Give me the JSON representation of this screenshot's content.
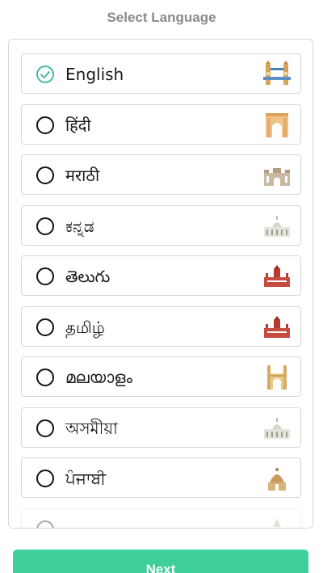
{
  "header": {
    "title": "Select Language"
  },
  "languages": [
    {
      "label": "English",
      "selected": true,
      "landmark_icon": "tower-bridge-icon"
    },
    {
      "label": "हिंदी",
      "selected": false,
      "landmark_icon": "india-gate-icon"
    },
    {
      "label": "मराठी",
      "selected": false,
      "landmark_icon": "gateway-of-india-icon"
    },
    {
      "label": "ಕನ್ನಡ",
      "selected": false,
      "landmark_icon": "vidhana-soudha-icon"
    },
    {
      "label": "తెలుగు",
      "selected": false,
      "landmark_icon": "palace-icon"
    },
    {
      "label": "தமிழ்",
      "selected": false,
      "landmark_icon": "palace-icon"
    },
    {
      "label": "മലയാളം",
      "selected": false,
      "landmark_icon": "charminar-icon"
    },
    {
      "label": "অসমীয়া",
      "selected": false,
      "landmark_icon": "vidhana-soudha-icon"
    },
    {
      "label": "ਪੰਜਾਬੀ",
      "selected": false,
      "landmark_icon": "temple-icon"
    }
  ],
  "footer": {
    "next_label": "Next"
  },
  "colors": {
    "accent": "#3ecf9a",
    "check": "#3ab4a0",
    "title": "#8a8a8a"
  }
}
